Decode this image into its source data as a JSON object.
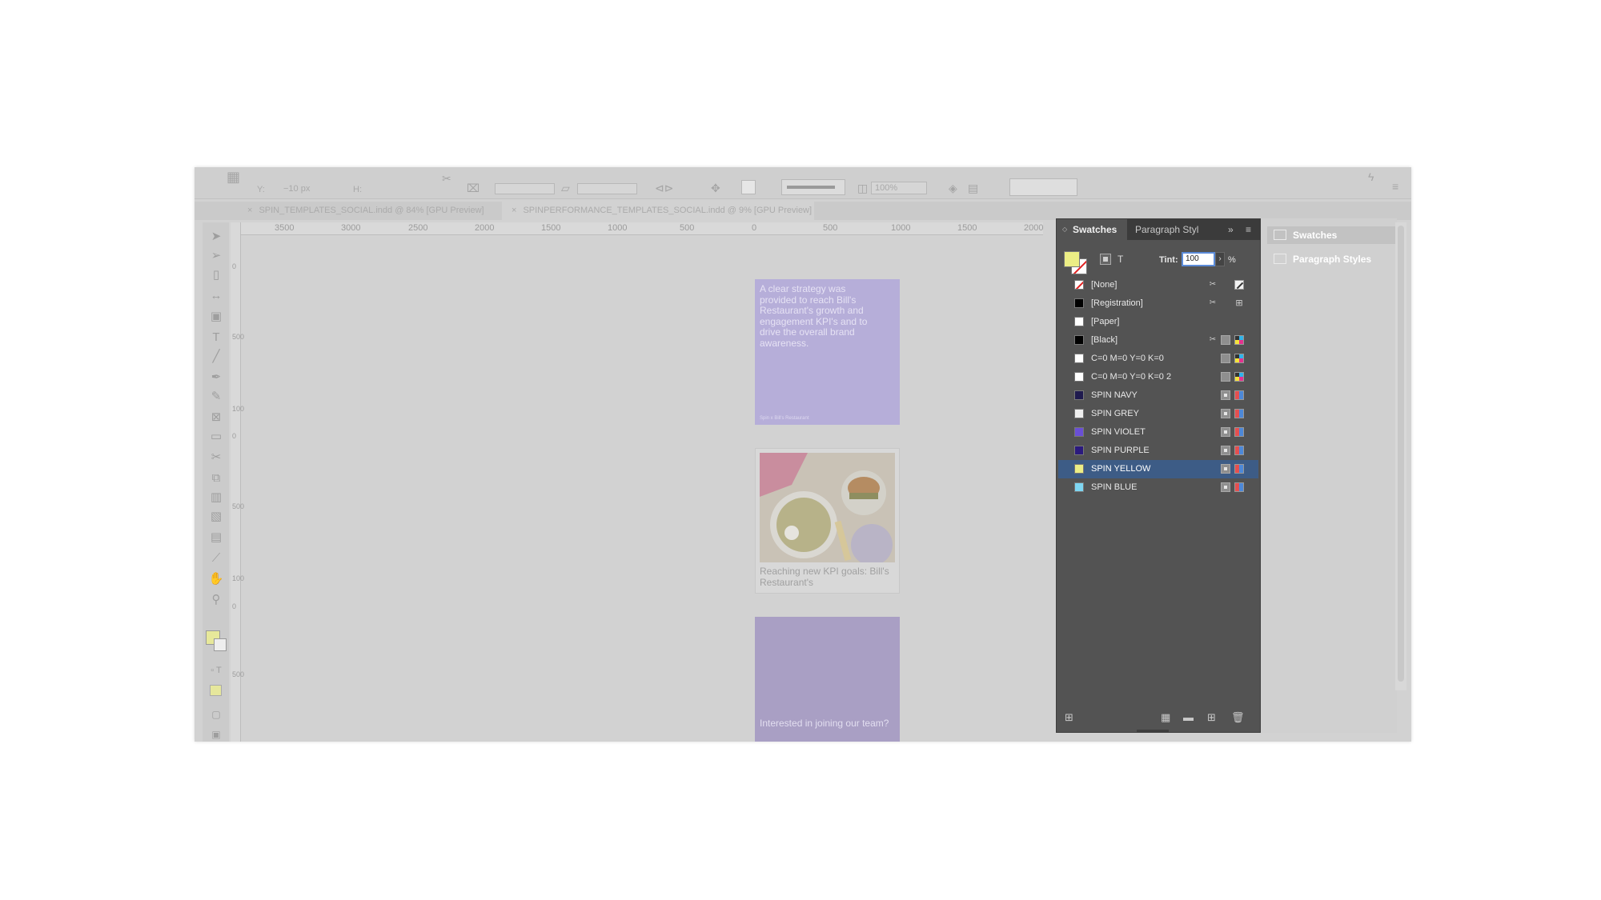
{
  "app": {
    "controlbar": {
      "y_label": "Y:",
      "y_value": "−10 px",
      "h_label": "H:",
      "zoom": "100%"
    },
    "tabs": [
      {
        "label": "SPIN_TEMPLATES_SOCIAL.indd @ 84% [GPU Preview]"
      },
      {
        "label": "SPINPERFORMANCE_TEMPLATES_SOCIAL.indd @ 9% [GPU Preview]"
      }
    ],
    "ruler": {
      "h_ticks": [
        "3500",
        "3000",
        "2500",
        "2000",
        "1500",
        "1000",
        "500",
        "0",
        "500",
        "1000",
        "1500",
        "2000"
      ],
      "v_ticks": [
        "0",
        "500",
        "100",
        "0",
        "500",
        "100",
        "0",
        "500"
      ]
    }
  },
  "pages": {
    "page_a": {
      "text": "A clear strategy was provided to reach Bill's Restaurant's growth and engagement KPI's and to drive the overall brand awareness.",
      "footer": "Spin x Bill's Restaurant"
    },
    "page_b": {
      "caption": "Reaching new KPI goals: Bill's Restaurant's"
    },
    "page_c": {
      "text": "Interested in joining our team?"
    }
  },
  "swatches_panel": {
    "tab_active": "Swatches",
    "tab_inactive": "Paragraph Styl",
    "expand_glyph": "»",
    "menu_glyph": "≡",
    "tint_label": "Tint:",
    "tint_value": "100",
    "tint_unit": "%",
    "fill_color": "#ecee85",
    "selected_index": 10,
    "swatches": [
      {
        "name": "[None]",
        "color": "none",
        "icons": [
          "scissors",
          "none"
        ]
      },
      {
        "name": "[Registration]",
        "color": "#000000",
        "icons": [
          "scissors",
          "registration"
        ]
      },
      {
        "name": "[Paper]",
        "color": "#ffffff",
        "icons": []
      },
      {
        "name": "[Black]",
        "color": "#000000",
        "icons": [
          "scissors",
          "grey",
          "cmyk"
        ]
      },
      {
        "name": "C=0 M=0 Y=0 K=0",
        "color": "#ffffff",
        "icons": [
          "grey",
          "cmyk"
        ]
      },
      {
        "name": "C=0 M=0 Y=0 K=0 2",
        "color": "#ffffff",
        "icons": [
          "grey",
          "cmyk"
        ]
      },
      {
        "name": "SPIN NAVY",
        "color": "#1f1a4e",
        "icons": [
          "grey-dot",
          "process"
        ]
      },
      {
        "name": "SPIN GREY",
        "color": "#efefef",
        "icons": [
          "grey-dot",
          "process"
        ]
      },
      {
        "name": "SPIN VIOLET",
        "color": "#6a4fd6",
        "icons": [
          "grey-dot",
          "process"
        ]
      },
      {
        "name": "SPIN PURPLE",
        "color": "#2b1a7e",
        "icons": [
          "grey-dot",
          "process"
        ]
      },
      {
        "name": "SPIN YELLOW",
        "color": "#ecee85",
        "icons": [
          "grey-dot",
          "process"
        ]
      },
      {
        "name": "SPIN BLUE",
        "color": "#7ed6f2",
        "icons": [
          "grey-dot",
          "process"
        ]
      }
    ]
  },
  "dock": {
    "items": [
      {
        "label": "Swatches"
      },
      {
        "label": "Paragraph Styles"
      }
    ]
  }
}
